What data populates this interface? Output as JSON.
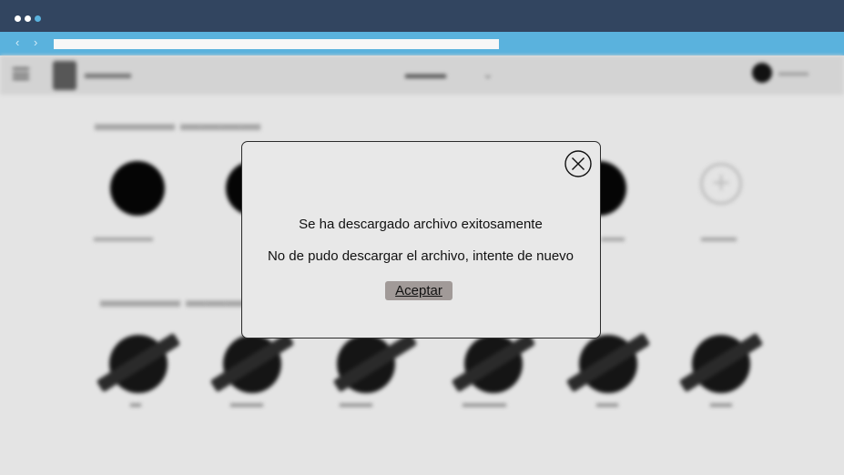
{
  "window": {
    "dots": [
      {
        "color": "#ffffff"
      },
      {
        "color": "#ffffff"
      },
      {
        "color": "#5ab2dd"
      }
    ],
    "back_icon": "chevron-left-icon",
    "forward_icon": "chevron-right-icon"
  },
  "modal": {
    "close_icon": "close-circle-icon",
    "message_success": "Se ha descargado archivo exitosamente",
    "message_error": "No de pudo descargar el archivo, intente de nuevo",
    "accept_label": "Aceptar"
  },
  "colors": {
    "titlebar": "#324560",
    "browserbar": "#5ab2dd",
    "modal_background": "#e8e8e8",
    "accept_button": "#a19a98"
  }
}
